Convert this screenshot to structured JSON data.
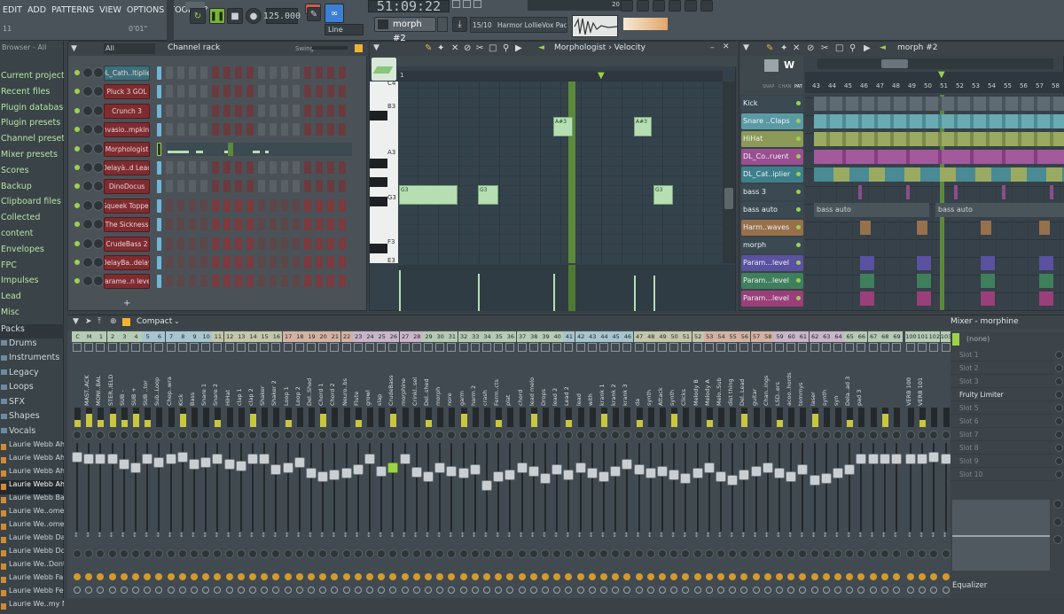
{
  "colors": {
    "accent_green": "#9bd34a",
    "channel_red": "#7f2c30",
    "bg": "#3a4247"
  },
  "menu": [
    "EDIT",
    "ADD",
    "PATTERNS",
    "VIEW",
    "OPTIONS",
    "TOOLS",
    "?"
  ],
  "toolbar": {
    "time": "51:09:22",
    "tempo": "125.000",
    "pattern": "morph #2",
    "snap": "Line",
    "hint_counter": "15/10",
    "hint_text": "Harmor LollieVox Pack",
    "small_left": "11",
    "small_mid": "0'01\"",
    "small_right": "20"
  },
  "browser": {
    "title": "Browser - All",
    "items": [
      "Current project",
      "Recent files",
      "Plugin database",
      "Plugin presets",
      "Channel presets",
      "Mixer presets",
      "Scores",
      "Backup",
      "Clipboard files",
      "Collected",
      "content",
      "Envelopes",
      "FPC",
      "Impulses",
      "Lead",
      "Misc"
    ],
    "packs_label": "Packs",
    "packs": [
      "Drums",
      "Instruments",
      "Legacy",
      "Loops",
      "SFX",
      "Shapes",
      "Vocals"
    ],
    "files": [
      "Laurie Webb Ahh A",
      "Laurie Webb Ahh B",
      "Laurie Webb Ahh C",
      "Laurie Webb Ahh D",
      "Laurie Webb Baby",
      "Laurie We..ome On A",
      "Laurie We..ome On B",
      "Laurie Webb Dance",
      "Laurie Webb Do It",
      "Laurie We..Dont Stop",
      "Laurie Webb Falling",
      "Laurie Webb Feel It",
      "Laurie We..my More"
    ]
  },
  "channel_rack": {
    "title": "Channel rack",
    "filter": "All",
    "swing_label": "Swing",
    "channels": [
      "DL_Cath..ltiplier",
      "Pluck 3 GOL",
      "Crunch 3",
      "Invasio..mpkins",
      "Morphologist",
      "Delayà..d Lead",
      "DinoDocus",
      "Squeek Topper",
      "The Sickness",
      "CrudeBass 2",
      "DelayBa..delay",
      "Parame..n level"
    ]
  },
  "piano_roll": {
    "title": "Morphologist › Velocity",
    "keys": [
      "C4",
      "B3",
      "A3",
      "G3",
      "F3",
      "E3"
    ],
    "bar_marker": "1",
    "note_labels": [
      "A#3",
      "A#3",
      "G3",
      "G3",
      "G3"
    ]
  },
  "playlist": {
    "title": "morph #2",
    "bars": [
      "43",
      "44",
      "45",
      "46",
      "47",
      "48",
      "49",
      "50",
      "51",
      "52",
      "53",
      "54",
      "55",
      "56",
      "57",
      "58"
    ],
    "header_tabs": [
      "SNAP",
      "CHAN",
      "PAT"
    ],
    "tracks": [
      {
        "name": "Kick",
        "color": "#3b4a52"
      },
      {
        "name": "Snare ..Claps",
        "color": "#5a9aa4"
      },
      {
        "name": "HiHat",
        "color": "#8b9a58"
      },
      {
        "name": "DL_Co..ruent",
        "color": "#9a4f93"
      },
      {
        "name": "DL_Cat..iplier",
        "color": "#3d7f8a"
      },
      {
        "name": "bass 3",
        "color": "#3b4a52"
      },
      {
        "name": "bass auto",
        "color": "#3b4a52"
      },
      {
        "name": "Harm..waves",
        "color": "#97704c"
      },
      {
        "name": "morph",
        "color": "#3b4a52"
      },
      {
        "name": "Param...level",
        "color": "#5a51a0"
      },
      {
        "name": "Param...level",
        "color": "#3f7f5c"
      },
      {
        "name": "Param...level",
        "color": "#9a3f7a"
      }
    ],
    "auto_clip_label": "bass auto"
  },
  "mixer": {
    "title": "Compact",
    "panel_title": "Mixer - morphine",
    "insert_none": "(none)",
    "slots": [
      "Slot 1",
      "Slot 2",
      "Slot 3",
      "Fruity Limiter",
      "Slot 5",
      "Slot 6",
      "Slot 7",
      "Slot 8",
      "Slot 9",
      "Slot 10"
    ],
    "eq_label": "Equalizer",
    "tracks": [
      {
        "n": "C",
        "name": ""
      },
      {
        "n": "M",
        "name": "MAST..ACK"
      },
      {
        "n": "1",
        "name": "MONI..BAL"
      },
      {
        "n": "2",
        "name": "STER..IELD"
      },
      {
        "n": "3",
        "name": "SUB -"
      },
      {
        "n": "4",
        "name": "SUB +"
      },
      {
        "n": "5",
        "name": "SUB ..tor"
      },
      {
        "n": "6",
        "name": "Sub..Loop"
      },
      {
        "n": "7",
        "name": "Chop..wra"
      },
      {
        "n": "8",
        "name": "Kick"
      },
      {
        "n": "9",
        "name": "Bass"
      },
      {
        "n": "10",
        "name": "Snare 1"
      },
      {
        "n": "11",
        "name": "Snare 2"
      },
      {
        "n": "12",
        "name": "HiHat"
      },
      {
        "n": "13",
        "name": "clap 1"
      },
      {
        "n": "14",
        "name": "clap 2"
      },
      {
        "n": "15",
        "name": "Shaker"
      },
      {
        "n": "16",
        "name": "Shaker 2"
      },
      {
        "n": "17",
        "name": "Loop 1"
      },
      {
        "n": "18",
        "name": "Loop 2"
      },
      {
        "n": "19",
        "name": "Del..Shed"
      },
      {
        "n": "20",
        "name": "Chord 1"
      },
      {
        "n": "21",
        "name": "Chord 2"
      },
      {
        "n": "22",
        "name": "Neuro..bs"
      },
      {
        "n": "23",
        "name": "Flute"
      },
      {
        "n": "24",
        "name": "growl"
      },
      {
        "n": "25",
        "name": "slap"
      },
      {
        "n": "26",
        "name": "CrudeBass"
      },
      {
        "n": "27",
        "name": "morphine"
      },
      {
        "n": "28",
        "name": "Crinkl..sel"
      },
      {
        "n": "29",
        "name": "Del..shed"
      },
      {
        "n": "30",
        "name": "morph"
      },
      {
        "n": "31",
        "name": "nore"
      },
      {
        "n": "32",
        "name": "garm"
      },
      {
        "n": "33",
        "name": "harm 2"
      },
      {
        "n": "34",
        "name": "crash"
      },
      {
        "n": "35",
        "name": "Ferm..cts"
      },
      {
        "n": "36",
        "name": "plat"
      },
      {
        "n": "37",
        "name": "chord"
      },
      {
        "n": "38",
        "name": "lead melo"
      },
      {
        "n": "39",
        "name": "Drops"
      },
      {
        "n": "40",
        "name": "lead 2"
      },
      {
        "n": "41",
        "name": "Lead 2"
      },
      {
        "n": "42",
        "name": "lead"
      },
      {
        "n": "43",
        "name": "with"
      },
      {
        "n": "44",
        "name": "krank 1"
      },
      {
        "n": "45",
        "name": "krank 2"
      },
      {
        "n": "46",
        "name": "krank 3"
      },
      {
        "n": "47",
        "name": "da"
      },
      {
        "n": "48",
        "name": "synth"
      },
      {
        "n": "49",
        "name": "Attack"
      },
      {
        "n": "50",
        "name": "synth"
      },
      {
        "n": "51",
        "name": "Clicks"
      },
      {
        "n": "52",
        "name": "Melody B"
      },
      {
        "n": "53",
        "name": "Melody A"
      },
      {
        "n": "54",
        "name": "Melo..Sub"
      },
      {
        "n": "55",
        "name": "dist thing"
      },
      {
        "n": "56",
        "name": "Del..Lead"
      },
      {
        "n": "57",
        "name": "guitar"
      },
      {
        "n": "58",
        "name": "Chan..ings"
      },
      {
        "n": "59",
        "name": "LSD..ers"
      },
      {
        "n": "60",
        "name": "acoo..hords"
      },
      {
        "n": "61",
        "name": "tommys"
      },
      {
        "n": "62",
        "name": "laser"
      },
      {
        "n": "63",
        "name": "synth"
      },
      {
        "n": "64",
        "name": "syn"
      },
      {
        "n": "65",
        "name": "Dela..ad 3"
      },
      {
        "n": "66",
        "name": "pad 3"
      },
      {
        "n": "67",
        "name": ""
      },
      {
        "n": "68",
        "name": ""
      },
      {
        "n": "69",
        "name": ""
      },
      {
        "n": "100",
        "name": "VERB 100"
      },
      {
        "n": "101",
        "name": "VERB 101"
      },
      {
        "n": "102",
        "name": ""
      },
      {
        "n": "103",
        "name": ""
      }
    ]
  }
}
